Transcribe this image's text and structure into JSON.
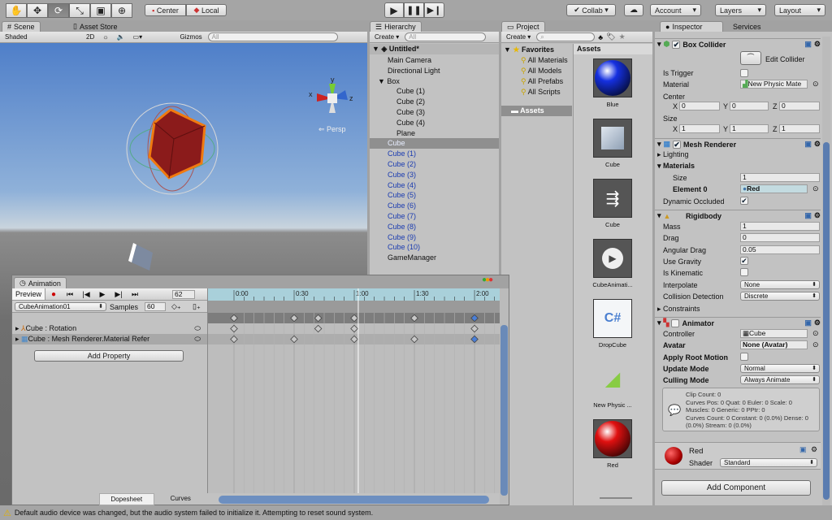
{
  "toolbar": {
    "tools": [
      "hand-icon",
      "move-icon",
      "rotate-icon",
      "scale-icon",
      "rect-icon",
      "transform-icon"
    ],
    "active_tool": 2,
    "pivot": "Center",
    "space": "Local",
    "collab": "Collab",
    "account": "Account",
    "layers": "Layers",
    "layout": "Layout"
  },
  "scene": {
    "tabs": [
      "Scene",
      "Asset Store"
    ],
    "shading": "Shaded",
    "mode2d": "2D",
    "gizmos": "Gizmos",
    "search_placeholder": "All",
    "persp_label": "Persp",
    "axis_x": "x",
    "axis_y": "y",
    "axis_z": "z"
  },
  "hierarchy": {
    "tab": "Hierarchy",
    "create": "Create",
    "search_placeholder": "All",
    "scene": "Untitled*",
    "items": [
      {
        "label": "Main Camera",
        "depth": 1
      },
      {
        "label": "Directional Light",
        "depth": 1
      },
      {
        "label": "Box",
        "depth": 1,
        "expanded": true
      },
      {
        "label": "Cube (1)",
        "depth": 2
      },
      {
        "label": "Cube (2)",
        "depth": 2
      },
      {
        "label": "Cube (3)",
        "depth": 2
      },
      {
        "label": "Cube (4)",
        "depth": 2
      },
      {
        "label": "Plane",
        "depth": 2
      },
      {
        "label": "Cube",
        "depth": 1,
        "prefab": true,
        "selected": true
      },
      {
        "label": "Cube (1)",
        "depth": 1,
        "prefab": true
      },
      {
        "label": "Cube (2)",
        "depth": 1,
        "prefab": true
      },
      {
        "label": "Cube (3)",
        "depth": 1,
        "prefab": true
      },
      {
        "label": "Cube (4)",
        "depth": 1,
        "prefab": true
      },
      {
        "label": "Cube (5)",
        "depth": 1,
        "prefab": true
      },
      {
        "label": "Cube (6)",
        "depth": 1,
        "prefab": true
      },
      {
        "label": "Cube (7)",
        "depth": 1,
        "prefab": true
      },
      {
        "label": "Cube (8)",
        "depth": 1,
        "prefab": true
      },
      {
        "label": "Cube (9)",
        "depth": 1,
        "prefab": true
      },
      {
        "label": "Cube (10)",
        "depth": 1,
        "prefab": true
      },
      {
        "label": "GameManager",
        "depth": 1
      }
    ]
  },
  "project": {
    "tab": "Project",
    "create": "Create",
    "favorites": "Favorites",
    "favorite_items": [
      "All Materials",
      "All Models",
      "All Prefabs",
      "All Scripts"
    ],
    "assets_folder": "Assets",
    "assets_header": "Assets",
    "assets": [
      {
        "name": "Blue",
        "kind": "material",
        "color": "#1530e0"
      },
      {
        "name": "Cube",
        "kind": "prefab"
      },
      {
        "name": "Cube",
        "kind": "controller"
      },
      {
        "name": "CubeAnimati...",
        "kind": "animation"
      },
      {
        "name": "DropCube",
        "kind": "script",
        "glyph": "C#"
      },
      {
        "name": "New Physic ...",
        "kind": "physic-material"
      },
      {
        "name": "Red",
        "kind": "material",
        "color": "#e01010"
      }
    ]
  },
  "inspector": {
    "tabs": [
      "Inspector",
      "Services"
    ],
    "box_collider": {
      "title": "Box Collider",
      "enabled": true,
      "edit_collider": "Edit Collider",
      "is_trigger_label": "Is Trigger",
      "is_trigger": false,
      "material_label": "Material",
      "material": "New Physic Mate",
      "center_label": "Center",
      "center": {
        "x": "0",
        "y": "0",
        "z": "0"
      },
      "size_label": "Size",
      "size": {
        "x": "1",
        "y": "1",
        "z": "1"
      }
    },
    "mesh_renderer": {
      "title": "Mesh Renderer",
      "enabled": true,
      "lighting": "Lighting",
      "materials": "Materials",
      "size_label": "Size",
      "size": "1",
      "element0_label": "Element 0",
      "element0": "Red",
      "dynamic_occluded_label": "Dynamic Occluded",
      "dynamic_occluded": true
    },
    "rigidbody": {
      "title": "Rigidbody",
      "mass_label": "Mass",
      "mass": "1",
      "drag_label": "Drag",
      "drag": "0",
      "angular_drag_label": "Angular Drag",
      "angular_drag": "0.05",
      "use_gravity_label": "Use Gravity",
      "use_gravity": true,
      "is_kinematic_label": "Is Kinematic",
      "is_kinematic": false,
      "interpolate_label": "Interpolate",
      "interpolate": "None",
      "collision_label": "Collision Detection",
      "collision": "Discrete",
      "constraints": "Constraints"
    },
    "animator": {
      "title": "Animator",
      "enabled": false,
      "controller_label": "Controller",
      "controller": "Cube",
      "avatar_label": "Avatar",
      "avatar": "None (Avatar)",
      "root_motion_label": "Apply Root Motion",
      "root_motion": false,
      "update_label": "Update Mode",
      "update": "Normal",
      "culling_label": "Culling Mode",
      "culling": "Always Animate",
      "info": [
        "Clip Count: 0",
        "Curves Pos: 0 Quat: 0 Euler: 0 Scale: 0",
        "Muscles: 0 Generic: 0 PPtr: 0",
        "Curves Count: 0 Constant: 0 (0.0%) Dense: 0",
        "(0.0%) Stream: 0 (0.0%)"
      ]
    },
    "material": {
      "name": "Red",
      "shader_label": "Shader",
      "shader": "Standard",
      "color": "#c00000"
    },
    "add_component": "Add Component"
  },
  "animation": {
    "tab": "Animation",
    "preview": "Preview",
    "frame": "62",
    "clip": "CubeAnimation01",
    "samples_label": "Samples",
    "samples": "60",
    "tracks": [
      {
        "label": "Cube : Rotation",
        "keys": [
          0,
          42,
          60,
          120
        ]
      },
      {
        "label": "Cube : Mesh Renderer.Material Refer",
        "keys": [
          0,
          30,
          60,
          90,
          120
        ],
        "selected_keys": [
          120
        ]
      }
    ],
    "summary_keys": [
      0,
      30,
      42,
      60,
      90,
      120
    ],
    "time_labels": [
      "0:00",
      "0:30",
      "1:00",
      "1:30",
      "2:00"
    ],
    "add_property": "Add Property",
    "tab_dopesheet": "Dopesheet",
    "tab_curves": "Curves"
  },
  "status": {
    "message": "Default audio device was changed, but the audio system failed to initialize it. Attempting to reset sound system."
  }
}
